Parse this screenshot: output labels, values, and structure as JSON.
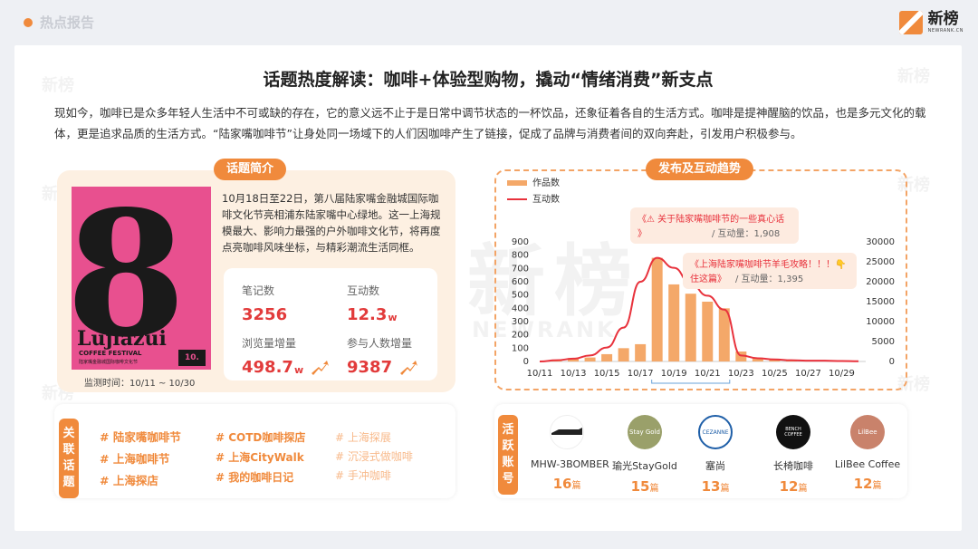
{
  "header": {
    "label": "热点报告",
    "logo_cn": "新榜",
    "logo_en": "NEWRANK.CN"
  },
  "watermark": {
    "cn": "新榜",
    "en": "NEWRANK"
  },
  "title": "话题热度解读：咖啡+体验型购物，撬动“情绪消费”新支点",
  "intro": "现如今，咖啡已是众多年轻人生活中不可或缺的存在，它的意义远不止于是日常中调节状态的一杯饮品，还象征着各自的生活方式。咖啡是提神醒脑的饮品，也是多元文化的载体，更是追求品质的生活方式。“陆家嘴咖啡节”让身处同一场域下的人们因咖啡产生了链接，促成了品牌与消费者间的双向奔赴，引发用户积极参与。",
  "topic": {
    "pill": "话题简介",
    "desc": "10月18日至22日，第八届陆家嘴金融城国际咖啡文化节亮相浦东陆家嘴中心绿地。这一上海规模最大、影响力最强的户外咖啡文化节，将再度点亮咖啡风味坐标，与精彩潮流生活同框。",
    "monitor": "监测时间：10/11 ~ 10/30",
    "poster": {
      "big": "8",
      "brand": "Lujiazui",
      "sub": "COFFEE FESTIVAL",
      "cn": "陆家嘴金融城国际咖啡文化节",
      "date": "10."
    },
    "stats": [
      {
        "k": "笔记数",
        "v": "3256",
        "u": ""
      },
      {
        "k": "互动数",
        "v": "12.3",
        "u": "w"
      },
      {
        "k": "浏览量增量",
        "v": "498.7",
        "u": "w"
      },
      {
        "k": "参与人数增量",
        "v": "9387",
        "u": ""
      }
    ]
  },
  "trend": {
    "pill": "发布及互动趋势",
    "colors": {
      "bar": "#f4a869",
      "line": "#e8323c"
    },
    "callouts": [
      {
        "text": "《⚠ 关于陆家嘴咖啡节的一些真心话》",
        "metric": "/ 互动量：1,908"
      },
      {
        "text": "《上海陆家嘴咖啡节羊毛攻略！！！👇住这篇》",
        "metric": "/ 互动量：1,395"
      }
    ]
  },
  "chart_data": {
    "type": "bar",
    "legend": [
      "作品数",
      "互动数"
    ],
    "x_ticks": [
      "10/11",
      "10/13",
      "10/15",
      "10/17",
      "10/19",
      "10/21",
      "10/23",
      "10/25",
      "10/27",
      "10/29"
    ],
    "left_ticks": [
      "0",
      "100",
      "200",
      "300",
      "400",
      "500",
      "600",
      "700",
      "800",
      "900"
    ],
    "right_ticks": [
      "0",
      "5000",
      "10000",
      "15000",
      "20000",
      "25000",
      "30000"
    ],
    "ylim_left": [
      0,
      900
    ],
    "ylim_right": [
      0,
      30000
    ],
    "series": [
      {
        "name": "作品数",
        "type": "bar",
        "x": [
          "10/12",
          "10/13",
          "10/14",
          "10/15",
          "10/16",
          "10/17",
          "10/18",
          "10/19",
          "10/20",
          "10/21",
          "10/22",
          "10/23",
          "10/24",
          "10/25",
          "10/26"
        ],
        "values": [
          10,
          25,
          30,
          55,
          100,
          130,
          780,
          580,
          510,
          450,
          400,
          75,
          20,
          12,
          8
        ]
      },
      {
        "name": "互动数",
        "type": "line",
        "x": [
          "10/11",
          "10/12",
          "10/13",
          "10/14",
          "10/15",
          "10/16",
          "10/17",
          "10/18",
          "10/19",
          "10/20",
          "10/21",
          "10/22",
          "10/23",
          "10/24",
          "10/25",
          "10/26",
          "10/27",
          "10/28",
          "10/29",
          "10/30"
        ],
        "values": [
          0,
          300,
          700,
          1500,
          3500,
          8500,
          20000,
          26000,
          23500,
          19500,
          16500,
          13000,
          1500,
          800,
          500,
          300,
          200,
          200,
          100,
          50
        ]
      }
    ]
  },
  "related": {
    "tag": "关联话题",
    "topics": [
      "# 陆家嘴咖啡节",
      "# 上海咖啡节",
      "# 上海探店",
      "# COTD咖啡探店",
      "# 上海CityWalk",
      "# 我的咖啡日记",
      "# 上海探展",
      "# 沉浸式做咖啡",
      "# 手冲咖啡"
    ]
  },
  "accounts": {
    "tag": "活跃账号",
    "unit": "篇",
    "items": [
      {
        "name": "MHW-3BOMBER",
        "count": "16",
        "icon": "mhw-logo",
        "color": "#222222"
      },
      {
        "name": "瑜光StayGold",
        "count": "15",
        "icon": "staygold-logo",
        "color": "#9aa06a",
        "label": "Stay Gold"
      },
      {
        "name": "塞尚",
        "count": "13",
        "icon": "cezanne-logo",
        "color": "#1f5fa8",
        "label": "CEZANNE"
      },
      {
        "name": "长椅咖啡",
        "count": "12",
        "icon": "bench-logo",
        "color": "#111111",
        "label": "BENCH COFFEE"
      },
      {
        "name": "LilBee Coffee",
        "count": "12",
        "icon": "lilbee-logo",
        "color": "#c9826b",
        "label": "LilBee"
      }
    ]
  }
}
